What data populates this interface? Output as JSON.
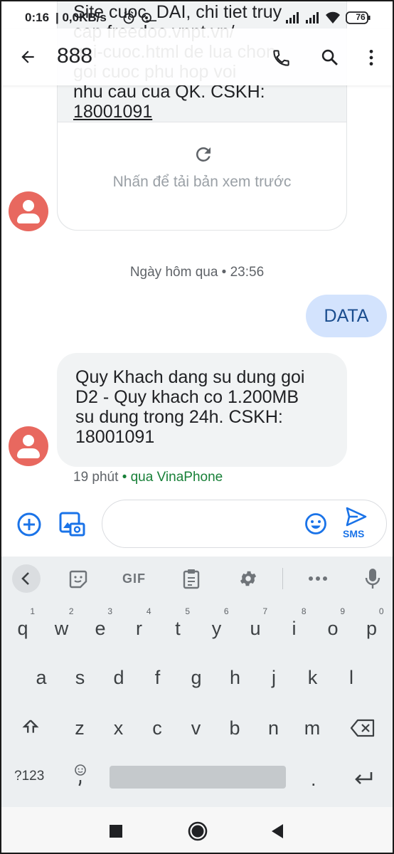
{
  "status_bar": {
    "time": "0:16",
    "data_rate": "| 0,0KB/s",
    "battery": "76"
  },
  "header": {
    "title": "888"
  },
  "messages": {
    "partial_received": {
      "text": "Site cuoc_DAI, chi tiet truy\ncap freedoo.vnpt.vn/\ngoi-cuoc.html de lua chon\ngoi cuoc phu hop voi\nnhu cau cua QK. CSKH:",
      "phone": "18001091",
      "preview_text": "Nhấn để tải bản xem trước"
    },
    "timestamp": "Ngày hôm qua • 23:56",
    "sent": {
      "text": "DATA"
    },
    "received": {
      "text": "Quy Khach dang su dung goi\nD2 - Quy khach co 1.200MB\nsu dung trong 24h. CSKH:\n18001091",
      "age": "19 phút",
      "carrier": "• qua VinaPhone"
    }
  },
  "composer": {
    "send_label": "SMS"
  },
  "keyboard": {
    "gif_label": "GIF",
    "row1": [
      {
        "key": "q",
        "num": "1"
      },
      {
        "key": "w",
        "num": "2"
      },
      {
        "key": "e",
        "num": "3"
      },
      {
        "key": "r",
        "num": "4"
      },
      {
        "key": "t",
        "num": "5"
      },
      {
        "key": "y",
        "num": "6"
      },
      {
        "key": "u",
        "num": "7"
      },
      {
        "key": "i",
        "num": "8"
      },
      {
        "key": "o",
        "num": "9"
      },
      {
        "key": "p",
        "num": "0"
      }
    ],
    "row2": [
      "a",
      "s",
      "d",
      "f",
      "g",
      "h",
      "j",
      "k",
      "l"
    ],
    "row3": [
      "z",
      "x",
      "c",
      "v",
      "b",
      "n",
      "m"
    ],
    "symbols_label": "?123",
    "period": "."
  },
  "colors": {
    "accent": "#1a73e8",
    "avatar": "#e8685f",
    "sent_bubble": "#d3e3fd",
    "received_bubble": "#f1f3f4",
    "carrier": "#188038"
  }
}
